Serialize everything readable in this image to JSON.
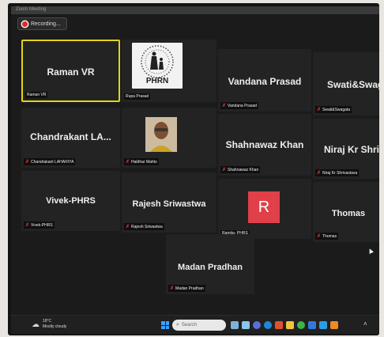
{
  "window": {
    "app_label": "Zoom Meeting"
  },
  "recording": {
    "label": "Recording..."
  },
  "participants": [
    {
      "name": "Raman VR",
      "tag": "Raman VR"
    },
    {
      "name": "",
      "tag": "Rupa Prasad",
      "logo_text": "PHRN"
    },
    {
      "name": "Vandana Prasad",
      "tag": "Vandana Prasad"
    },
    {
      "name": "Swati&Swagata",
      "tag": "Swati&Swagata"
    },
    {
      "name": "Chandrakant LA...",
      "tag": "Chandrakant LAHARIYA"
    },
    {
      "name": "",
      "tag": "Haldhar Mahto"
    },
    {
      "name": "Shahnawaz Khan",
      "tag": "Shahnawaz Khan"
    },
    {
      "name": "Niraj Kr Shrivast...",
      "tag": "Niraj Kr Shrivastava"
    },
    {
      "name": "Vivek-PHRS",
      "tag": "Vivek-PHRS"
    },
    {
      "name": "Rajesh Sriwastwa",
      "tag": "Rajesh Sriwastwa"
    },
    {
      "name": "",
      "tag": "Ramita- PHRS",
      "avatar_letter": "R"
    },
    {
      "name": "Thomas",
      "tag": "Thomas"
    },
    {
      "name": "Madan Pradhan",
      "tag": "Madan Pradhan"
    }
  ],
  "taskbar": {
    "weather_temp": "18°C",
    "weather_desc": "Mostly cloudy",
    "search_placeholder": "Search"
  },
  "colors": {
    "active_speaker_border": "#e3d31a",
    "avatar_bg": "#e04048",
    "mute_icon": "#e33232"
  }
}
